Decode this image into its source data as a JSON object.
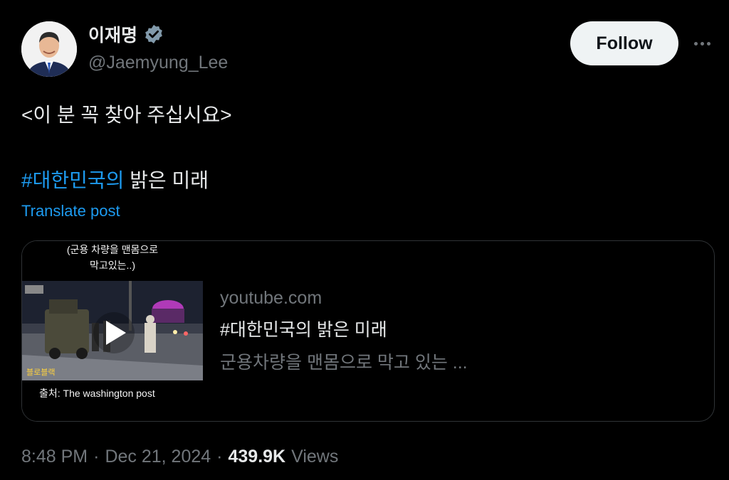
{
  "author": {
    "display_name": "이재명",
    "handle": "@Jaemyung_Lee",
    "verified_icon": "verified-badge-icon"
  },
  "actions": {
    "follow_label": "Follow",
    "more_icon": "more-horizontal-icon"
  },
  "post": {
    "line1": "<이 분 꼭 찾아 주십시요>",
    "hashtag": "#대한민국의",
    "line2_rest": " 밝은 미래",
    "translate_label": "Translate post"
  },
  "link_card": {
    "thumbnail": {
      "caption_top_1": "(군용 차량을 맨몸으로",
      "caption_top_2": "막고있는..)",
      "caption_bottom": "출처: The washington post",
      "caption_mid": "블로블랙"
    },
    "domain": "youtube.com",
    "title": "#대한민국의 밝은 미래",
    "description": "군용차량을 맨몸으로 막고 있는 ..."
  },
  "meta": {
    "time": "8:48 PM",
    "sep1": "·",
    "date": "Dec 21, 2024",
    "sep2": "·",
    "views_count": "439.9K",
    "views_label": "Views"
  },
  "colors": {
    "background": "#000000",
    "link_blue": "#1d9bf0",
    "secondary_text": "#71767b",
    "primary_text": "#e7e9ea"
  }
}
